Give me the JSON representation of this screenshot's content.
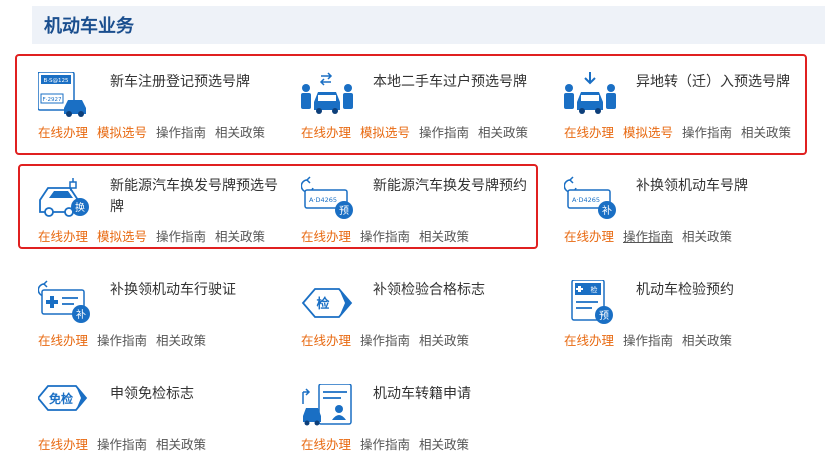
{
  "section_title": "机动车业务",
  "colors": {
    "accent_blue": "#1a6fc4",
    "link_orange": "#e86a12",
    "highlight_red": "#e02020"
  },
  "cards": [
    {
      "title": "新车注册登记预选号牌",
      "icon": "new-car-plate-icon",
      "links": [
        "在线办理",
        "模拟选号",
        "操作指南",
        "相关政策"
      ]
    },
    {
      "title": "本地二手车过户预选号牌",
      "icon": "used-car-transfer-icon",
      "links": [
        "在线办理",
        "模拟选号",
        "操作指南",
        "相关政策"
      ]
    },
    {
      "title": "异地转（迁）入预选号牌",
      "icon": "transfer-in-icon",
      "links": [
        "在线办理",
        "模拟选号",
        "操作指南",
        "相关政策"
      ]
    },
    {
      "title": "新能源汽车换发号牌预选号牌",
      "icon": "ev-plate-replace-icon",
      "badge": "换",
      "links": [
        "在线办理",
        "模拟选号",
        "操作指南",
        "相关政策"
      ]
    },
    {
      "title": "新能源汽车换发号牌预约",
      "icon": "ev-plate-appointment-icon",
      "badge": "预",
      "plate_text": "A·D4265",
      "links": [
        "在线办理",
        "操作指南",
        "相关政策"
      ]
    },
    {
      "title": "补换领机动车号牌",
      "icon": "plate-reissue-icon",
      "badge": "补",
      "plate_text": "A·D4265",
      "links": [
        "在线办理",
        "操作指南",
        "相关政策"
      ]
    },
    {
      "title": "补换领机动车行驶证",
      "icon": "license-reissue-icon",
      "badge": "补",
      "links": [
        "在线办理",
        "操作指南",
        "相关政策"
      ]
    },
    {
      "title": "补领检验合格标志",
      "icon": "inspection-mark-icon",
      "badge": "检",
      "links": [
        "在线办理",
        "操作指南",
        "相关政策"
      ]
    },
    {
      "title": "机动车检验预约",
      "icon": "inspection-appointment-icon",
      "badge": "预",
      "badge2": "检",
      "links": [
        "在线办理",
        "操作指南",
        "相关政策"
      ]
    },
    {
      "title": "申领免检标志",
      "icon": "exemption-mark-icon",
      "badge": "免检",
      "links": [
        "在线办理",
        "操作指南",
        "相关政策"
      ]
    },
    {
      "title": "机动车转籍申请",
      "icon": "registration-transfer-icon",
      "links": [
        "在线办理",
        "操作指南",
        "相关政策"
      ]
    }
  ]
}
